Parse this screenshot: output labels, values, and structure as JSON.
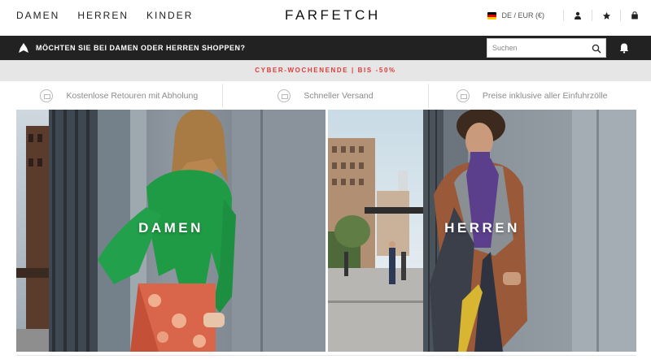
{
  "header": {
    "nav": [
      {
        "label": "DAMEN"
      },
      {
        "label": "HERREN"
      },
      {
        "label": "KINDER"
      }
    ],
    "logo": "FARFETCH",
    "locale": "DE / EUR (€)",
    "icons": [
      "germany-flag-icon",
      "user-icon",
      "star-icon",
      "shopping-bag-icon"
    ]
  },
  "darkbar": {
    "prompt": "MÖCHTEN SIE BEI DAMEN ODER HERREN SHOPPEN?",
    "search_placeholder": "Suchen"
  },
  "promo": {
    "text": "CYBER-WOCHENENDE | BIS -50%",
    "color": "#e03a3a"
  },
  "usps": [
    {
      "icon": "return-icon",
      "label": "Kostenlose Retouren mit Abholung"
    },
    {
      "icon": "delivery-icon",
      "label": "Schneller Versand"
    },
    {
      "icon": "customs-icon",
      "label": "Preise inklusive aller Einfuhrzölle"
    }
  ],
  "hero": {
    "left_label": "DAMEN",
    "right_label": "HERREN"
  },
  "colors": {
    "darkbar": "#222222",
    "promo_bg": "#e6e6e6",
    "text": "#222222"
  }
}
